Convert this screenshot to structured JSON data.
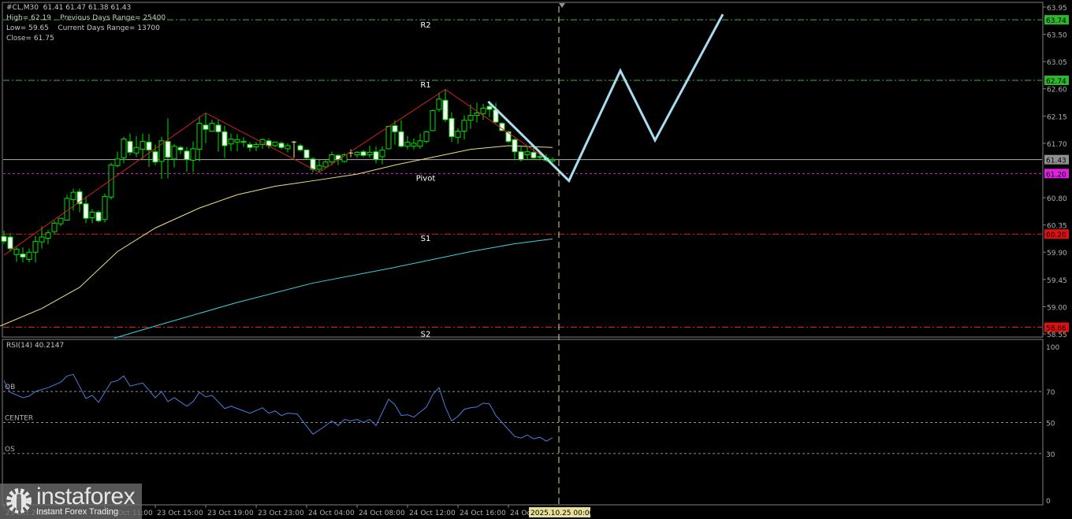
{
  "header": {
    "symbol_line": "#CL,M30  61.41 61.47 61.38 61.43",
    "high_line": "High= 62.19    Previous Days Range= 25400",
    "low_line": "Low= 59.65    Current Days Range= 13700",
    "close_line": "Close= 61.75"
  },
  "colors": {
    "bull": "#00e000",
    "bear_fill": "#ffffff",
    "ma_fast": "#f0e080",
    "ma_slow": "#40d0e0",
    "zigzag": "#d02020",
    "forecast": "#a8dcee",
    "rsi": "#4a7fe0",
    "resistance": "#40b040",
    "pivot": "#d030d0",
    "support": "#e02020"
  },
  "price_axis": {
    "ticks": [
      "63.95",
      "63.50",
      "63.05",
      "62.60",
      "62.15",
      "61.70",
      "60.80",
      "60.35",
      "59.90",
      "59.45",
      "59.00",
      "58.55"
    ]
  },
  "levels": [
    {
      "name": "R2",
      "price": 63.74,
      "label": "63.74",
      "kind": "resistance"
    },
    {
      "name": "R1",
      "price": 62.74,
      "label": "62.74",
      "kind": "resistance"
    },
    {
      "name": "Pivot",
      "price": 61.2,
      "label": "61.20",
      "kind": "pivot"
    },
    {
      "name": "S1",
      "price": 60.2,
      "label": "60.20",
      "kind": "support"
    },
    {
      "name": "S2",
      "price": 58.66,
      "label": "58.66",
      "kind": "support"
    }
  ],
  "current_price": {
    "price": 61.43,
    "label": "61.43"
  },
  "rsi": {
    "title": "RSI(14) 40.2147",
    "axis_ticks": [
      "100",
      "70",
      "50",
      "30",
      "0"
    ],
    "levels": [
      {
        "label": "OB",
        "value": 70
      },
      {
        "label": "CENTER",
        "value": 50
      },
      {
        "label": "OS",
        "value": 30
      }
    ],
    "points": [
      [
        0,
        77
      ],
      [
        1,
        69.5
      ],
      [
        3,
        66
      ],
      [
        4,
        67
      ],
      [
        5,
        70
      ],
      [
        7,
        72.5
      ],
      [
        9,
        76
      ],
      [
        10,
        80
      ],
      [
        11,
        81
      ],
      [
        13,
        65.5
      ],
      [
        14,
        67.5
      ],
      [
        15,
        63
      ],
      [
        17,
        76
      ],
      [
        18,
        77
      ],
      [
        19,
        80
      ],
      [
        20,
        73.5
      ],
      [
        22,
        75.5
      ],
      [
        24,
        66
      ],
      [
        25,
        70
      ],
      [
        26,
        63.5
      ],
      [
        27,
        66
      ],
      [
        29,
        60.5
      ],
      [
        30,
        63.5
      ],
      [
        31,
        69.5
      ],
      [
        32,
        66.5
      ],
      [
        33,
        67.5
      ],
      [
        35,
        59
      ],
      [
        36,
        60.5
      ],
      [
        37,
        59
      ],
      [
        39,
        56
      ],
      [
        41,
        59.5
      ],
      [
        42,
        56
      ],
      [
        43,
        57.5
      ],
      [
        44,
        54.5
      ],
      [
        45,
        56
      ],
      [
        46.5,
        55.5
      ],
      [
        49,
        42.5
      ],
      [
        50.5,
        46.5
      ],
      [
        52,
        51
      ],
      [
        53,
        48
      ],
      [
        54,
        52
      ],
      [
        55,
        51
      ],
      [
        56,
        52
      ],
      [
        57,
        50
      ],
      [
        58,
        52
      ],
      [
        59,
        48
      ],
      [
        61,
        65
      ],
      [
        62,
        61.5
      ],
      [
        63,
        54.5
      ],
      [
        64,
        55
      ],
      [
        65,
        53.5
      ],
      [
        67,
        60
      ],
      [
        68,
        68
      ],
      [
        69,
        72.5
      ],
      [
        70,
        60
      ],
      [
        71,
        51
      ],
      [
        72,
        54
      ],
      [
        73,
        58.5
      ],
      [
        74,
        59.5
      ],
      [
        75,
        60
      ],
      [
        76,
        62.5
      ],
      [
        77,
        62
      ],
      [
        78,
        54.5
      ],
      [
        79,
        50
      ],
      [
        81,
        41
      ],
      [
        82,
        40
      ],
      [
        83,
        42
      ],
      [
        84,
        39.5
      ],
      [
        85,
        40.5
      ],
      [
        86,
        38
      ],
      [
        87,
        40.2
      ]
    ]
  },
  "time_axis": {
    "labels": [
      {
        "bar": 0,
        "text": "23 Oct 2025"
      },
      {
        "bar": 16,
        "text": "23 Oct 11:00"
      },
      {
        "bar": 24,
        "text": "23 Oct 15:00"
      },
      {
        "bar": 32,
        "text": "23 Oct 19:00"
      },
      {
        "bar": 40,
        "text": "23 Oct 23:00"
      },
      {
        "bar": 48,
        "text": "24 Oct 04:00"
      },
      {
        "bar": 56,
        "text": "24 Oct 08:00"
      },
      {
        "bar": 64,
        "text": "24 Oct 12:00"
      },
      {
        "bar": 72,
        "text": "24 Oct 16:00"
      },
      {
        "bar": 80,
        "text": "24 Oct 20:00"
      }
    ],
    "highlight": {
      "bar": 88,
      "text": "2025.10.25 00:00"
    }
  },
  "candles": [
    [
      60.16,
      60.26,
      60.04,
      60.08
    ],
    [
      60.15,
      60.22,
      59.91,
      59.96
    ],
    [
      59.86,
      59.98,
      59.74,
      59.95
    ],
    [
      59.87,
      59.98,
      59.73,
      59.82
    ],
    [
      59.78,
      59.96,
      59.73,
      59.9
    ],
    [
      59.9,
      60.17,
      59.73,
      60.08
    ],
    [
      60.07,
      60.33,
      59.96,
      60.15
    ],
    [
      60.13,
      60.27,
      60.03,
      60.22
    ],
    [
      60.24,
      60.42,
      60.2,
      60.38
    ],
    [
      60.37,
      60.47,
      60.33,
      60.46
    ],
    [
      60.43,
      60.85,
      60.42,
      60.79
    ],
    [
      60.77,
      60.95,
      60.59,
      60.89
    ],
    [
      60.9,
      60.95,
      60.56,
      60.7
    ],
    [
      60.7,
      60.82,
      60.38,
      60.46
    ],
    [
      60.47,
      60.61,
      60.38,
      60.56
    ],
    [
      60.56,
      60.59,
      60.39,
      60.42
    ],
    [
      60.44,
      60.87,
      60.39,
      60.82
    ],
    [
      60.81,
      61.38,
      60.77,
      61.34
    ],
    [
      61.33,
      61.56,
      61.3,
      61.44
    ],
    [
      61.46,
      61.81,
      61.37,
      61.77
    ],
    [
      61.73,
      61.86,
      61.5,
      61.55
    ],
    [
      61.54,
      61.82,
      61.47,
      61.63
    ],
    [
      61.6,
      61.86,
      61.44,
      61.73
    ],
    [
      61.72,
      61.85,
      61.31,
      61.59
    ],
    [
      61.56,
      61.68,
      61.34,
      61.39
    ],
    [
      61.4,
      61.81,
      61.11,
      61.74
    ],
    [
      61.73,
      62.11,
      61.12,
      61.47
    ],
    [
      61.44,
      61.69,
      61.3,
      61.65
    ],
    [
      61.63,
      61.66,
      61.52,
      61.59
    ],
    [
      61.57,
      61.64,
      61.23,
      61.43
    ],
    [
      61.42,
      61.73,
      61.22,
      61.61
    ],
    [
      61.6,
      62.15,
      61.4,
      62.03
    ],
    [
      62.0,
      62.19,
      61.7,
      61.93
    ],
    [
      61.9,
      62.09,
      61.89,
      62.03
    ],
    [
      62.0,
      62.09,
      61.56,
      61.89
    ],
    [
      61.89,
      61.99,
      61.46,
      61.66
    ],
    [
      61.69,
      61.86,
      61.57,
      61.77
    ],
    [
      61.72,
      61.85,
      61.57,
      61.76
    ],
    [
      61.73,
      61.8,
      61.64,
      61.72
    ],
    [
      61.68,
      61.72,
      61.56,
      61.63
    ],
    [
      61.64,
      61.72,
      61.57,
      61.68
    ],
    [
      61.68,
      61.78,
      61.61,
      61.76
    ],
    [
      61.74,
      61.78,
      61.61,
      61.66
    ],
    [
      61.66,
      61.73,
      61.63,
      61.72
    ],
    [
      61.7,
      61.73,
      61.6,
      61.63
    ],
    [
      61.61,
      61.7,
      61.55,
      61.66
    ],
    [
      61.72,
      61.74,
      61.46,
      61.72
    ],
    [
      61.66,
      61.69,
      61.56,
      61.59
    ],
    [
      61.59,
      61.6,
      61.44,
      61.46
    ],
    [
      61.44,
      61.47,
      61.22,
      61.27
    ],
    [
      61.27,
      61.43,
      61.21,
      61.33
    ],
    [
      61.31,
      61.42,
      61.3,
      61.39
    ],
    [
      61.39,
      61.56,
      61.34,
      61.51
    ],
    [
      61.5,
      61.52,
      61.34,
      61.43
    ],
    [
      61.4,
      61.54,
      61.38,
      61.51
    ],
    [
      61.54,
      61.6,
      61.47,
      61.54
    ],
    [
      61.51,
      61.57,
      61.46,
      61.55
    ],
    [
      61.56,
      61.59,
      61.47,
      61.5
    ],
    [
      61.51,
      61.66,
      61.46,
      61.55
    ],
    [
      61.56,
      61.65,
      61.37,
      61.43
    ],
    [
      61.48,
      61.65,
      61.35,
      61.59
    ],
    [
      61.61,
      61.99,
      61.6,
      61.98
    ],
    [
      61.99,
      62.08,
      61.68,
      61.89
    ],
    [
      61.89,
      62.08,
      61.63,
      61.65
    ],
    [
      61.65,
      61.82,
      61.6,
      61.72
    ],
    [
      61.65,
      61.78,
      61.6,
      61.7
    ],
    [
      61.65,
      61.86,
      61.61,
      61.74
    ],
    [
      61.73,
      61.91,
      61.7,
      61.89
    ],
    [
      61.91,
      62.26,
      61.9,
      62.24
    ],
    [
      62.26,
      62.54,
      62.22,
      62.43
    ],
    [
      62.41,
      62.59,
      62.05,
      62.09
    ],
    [
      62.11,
      62.21,
      61.72,
      61.81
    ],
    [
      61.8,
      61.95,
      61.69,
      61.9
    ],
    [
      61.9,
      62.16,
      61.76,
      62.08
    ],
    [
      62.08,
      62.34,
      61.94,
      62.16
    ],
    [
      62.16,
      62.37,
      62.04,
      62.2
    ],
    [
      62.19,
      62.35,
      62.09,
      62.28
    ],
    [
      62.31,
      62.37,
      62.13,
      62.26
    ],
    [
      62.25,
      62.37,
      62.03,
      62.05
    ],
    [
      62.03,
      62.05,
      61.9,
      61.91
    ],
    [
      61.89,
      61.91,
      61.7,
      61.73
    ],
    [
      61.76,
      61.78,
      61.44,
      61.56
    ],
    [
      61.56,
      61.65,
      61.4,
      61.43
    ],
    [
      61.51,
      61.66,
      61.42,
      61.56
    ],
    [
      61.55,
      61.65,
      61.43,
      61.46
    ],
    [
      61.48,
      61.54,
      61.42,
      61.47
    ],
    [
      61.46,
      61.52,
      61.39,
      61.42
    ],
    [
      61.41,
      61.47,
      61.38,
      61.43
    ]
  ],
  "ma_fast": [
    [
      -0.6,
      58.68
    ],
    [
      6,
      58.97
    ],
    [
      12,
      59.32
    ],
    [
      18,
      59.91
    ],
    [
      24,
      60.3
    ],
    [
      31,
      60.63
    ],
    [
      37,
      60.85
    ],
    [
      43,
      60.99
    ],
    [
      49,
      61.08
    ],
    [
      56,
      61.19
    ],
    [
      62,
      61.34
    ],
    [
      68,
      61.47
    ],
    [
      74,
      61.6
    ],
    [
      80,
      61.66
    ],
    [
      87,
      61.63
    ]
  ],
  "ma_slow": [
    [
      17.5,
      58.48
    ],
    [
      24,
      58.68
    ],
    [
      37,
      59.07
    ],
    [
      49,
      59.39
    ],
    [
      62,
      59.65
    ],
    [
      74,
      59.91
    ],
    [
      81,
      60.04
    ],
    [
      87,
      60.12
    ]
  ],
  "zigzag": [
    [
      0,
      59.85
    ],
    [
      32,
      62.2
    ],
    [
      50,
      61.22
    ],
    [
      70,
      62.59
    ],
    [
      86,
      61.44
    ]
  ],
  "forecast": [
    [
      76.8,
      62.39
    ],
    [
      89.6,
      61.08
    ],
    [
      97.75,
      62.9
    ],
    [
      103.25,
      61.75
    ],
    [
      114,
      63.83
    ]
  ],
  "logo": {
    "name": "instaforex",
    "tagline": "Instant Forex Trading"
  }
}
